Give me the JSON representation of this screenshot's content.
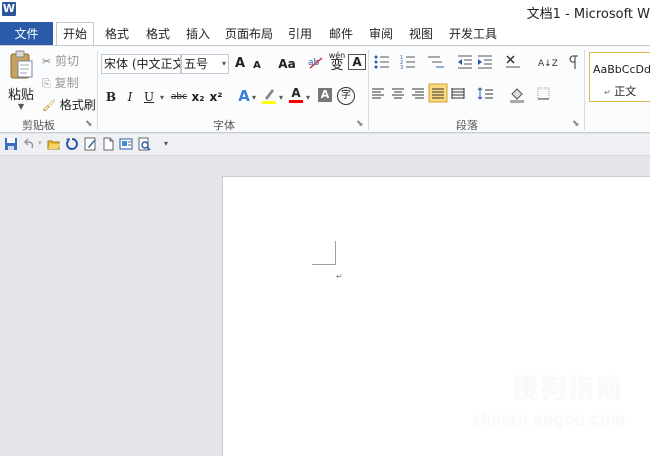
{
  "window": {
    "title": "文档1 - Microsoft W",
    "logo": "W"
  },
  "tabs": [
    "文件",
    "开始",
    "格式",
    "格式",
    "插入",
    "页面布局",
    "引用",
    "邮件",
    "审阅",
    "视图",
    "开发工具"
  ],
  "clipboard": {
    "paste_label": "粘贴",
    "cut_label": "剪切",
    "copy_label": "复制",
    "format_painter_label": "格式刷",
    "group_label": "剪贴板"
  },
  "font": {
    "font_name": "宋体 (中文正文",
    "font_size": "五号",
    "grow_label": "A",
    "shrink_label": "A",
    "case_label": "Aa",
    "bold": "B",
    "italic": "I",
    "underline": "U",
    "strike": "abc",
    "subscript": "x₂",
    "superscript": "x²",
    "effects_label": "A",
    "font_color_label": "A",
    "char_shading_label": "A",
    "enclose_label": "字",
    "phonetic_label": "wén",
    "border_label": "A",
    "group_label": "字体"
  },
  "paragraph": {
    "group_label": "段落",
    "sort_label": "A↓Z"
  },
  "styles": {
    "style1_sample": "AaBbCcDdI",
    "style1_name": "正文",
    "para_mark": "↵"
  },
  "watermark": {
    "brand": "搜狗指南",
    "url": "zhinan.sogou.com"
  },
  "colors": {
    "file_tab": "#2a5aa8",
    "ribbon_bg": "#fbfcfd",
    "workspace_bg": "#e4e6ea",
    "highlight": "#ffff00",
    "font_color": "#ff0000"
  }
}
